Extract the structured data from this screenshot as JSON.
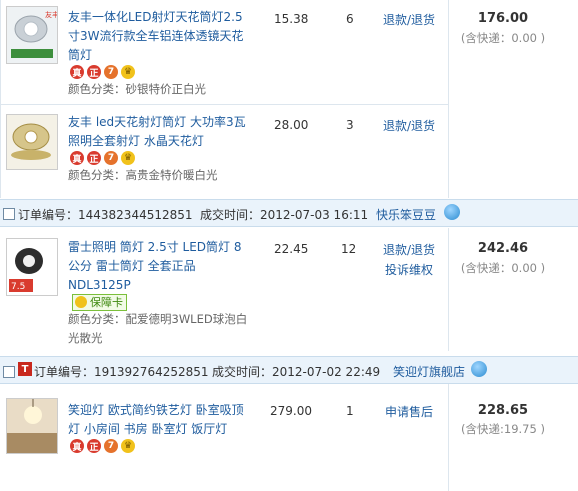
{
  "items": [
    {
      "title": "友丰一体化LED射灯天花筒灯2.5寸3W流行款全车铝连体透镜天花筒灯",
      "title_lines": [
        "友丰一体化LED射灯天花筒灯2.5",
        "寸3W流行款全车铝连体透镜天花",
        "筒灯"
      ],
      "spec": "颜色分类：砂银特价正白光",
      "price": "15.38",
      "qty": "6",
      "action": "退款/退货",
      "total": "176.00",
      "shipping": "(含快递：0.00 )",
      "thumb_label": "友丰"
    },
    {
      "title_lines": [
        "友丰 led天花射灯筒灯 大功率3瓦",
        "照明全套射灯 水晶天花灯"
      ],
      "spec": "颜色分类：高贵金特价暖白光",
      "price": "28.00",
      "qty": "3",
      "action": "退款/退货"
    },
    {
      "title_lines": [
        "雷士照明 筒灯 2.5寸 LED筒灯 8",
        "公分 雷士筒灯 全套正品",
        "NDL3125P"
      ],
      "guarantee": "保障卡",
      "spec_lines": [
        "颜色分类：配爱德明3WLED球泡白",
        "光散光"
      ],
      "price": "22.45",
      "qty": "12",
      "actions": [
        "退款/退货",
        "投诉维权"
      ],
      "total": "242.46",
      "shipping": "(含快递：0.00 )",
      "thumb_price": "7.5"
    },
    {
      "title_lines": [
        "笑迎灯 欧式简约铁艺灯 卧室吸顶",
        "灯 小房间 书房 卧室灯 饭厅灯"
      ],
      "price": "279.00",
      "qty": "1",
      "action": "申请售后",
      "total": "228.65",
      "shipping": "(含快递:19.75 )"
    }
  ],
  "orders": [
    {
      "order_no": "订单编号：144382344512851",
      "deal_time": "成交时间：2012-07-03 16:11",
      "shop": "快乐笨豆豆"
    },
    {
      "tmall_badge": "T",
      "order_no": "订单编号：191392764252851",
      "deal_time": "成交时间：2012-07-02 22:49",
      "shop": "笑迎灯旗舰店"
    }
  ],
  "badges": [
    "真",
    "正",
    "7",
    "♛"
  ],
  "colors": {
    "link": "#1f5c9e",
    "bar": "#eaf3fb",
    "red_badge": "#d93b2e"
  }
}
